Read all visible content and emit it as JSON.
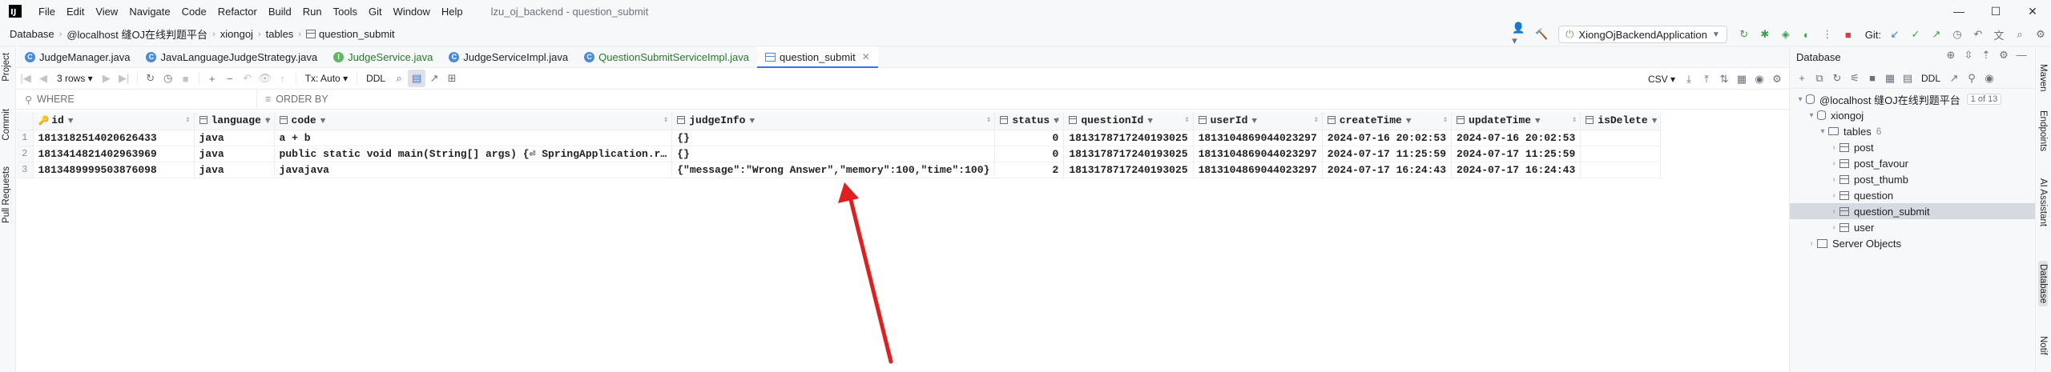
{
  "titlebar": {
    "app_logo": "IJ",
    "menu": [
      "File",
      "Edit",
      "View",
      "Navigate",
      "Code",
      "Refactor",
      "Build",
      "Run",
      "Tools",
      "Git",
      "Window",
      "Help"
    ],
    "window_title": "lzu_oj_backend - question_submit",
    "controls": {
      "minimize": "—",
      "maximize": "☐",
      "close": "✕"
    }
  },
  "navbar": {
    "breadcrumbs": [
      "Database",
      "@localhost 缝OJ在线判题平台",
      "xiongoj",
      "tables",
      "question_submit"
    ],
    "run_config": "XiongOjBackendApplication",
    "git_label": "Git:"
  },
  "left_strip": {
    "project": "Project",
    "commit": "Commit",
    "pull_requests": "Pull Requests"
  },
  "right_strip": {
    "maven": "Maven",
    "endpoints": "Endpoints",
    "ai_assistant": "AI Assistant",
    "database": "Database",
    "notifications": "Notif"
  },
  "editor_tabs": [
    {
      "label": "JudgeManager.java",
      "kind": "class"
    },
    {
      "label": "JavaLanguageJudgeStrategy.java",
      "kind": "class"
    },
    {
      "label": "JudgeService.java",
      "kind": "interface"
    },
    {
      "label": "JudgeServiceImpl.java",
      "kind": "class"
    },
    {
      "label": "QuestionSubmitServiceImpl.java",
      "kind": "class"
    },
    {
      "label": "question_submit",
      "kind": "table",
      "active": true
    }
  ],
  "grid_toolbar": {
    "rows_label": "3 rows",
    "tx_label": "Tx: Auto",
    "ddl_label": "DDL",
    "csv_label": "CSV"
  },
  "filter": {
    "where_label": "WHERE",
    "order_label": "ORDER BY"
  },
  "grid": {
    "columns": [
      "id",
      "language",
      "code",
      "judgeInfo",
      "status",
      "questionId",
      "userId",
      "createTime",
      "updateTime",
      "isDelete"
    ],
    "rows": [
      {
        "num": "1",
        "id": "1813182514020626433",
        "language": "java",
        "code": "a + b",
        "judgeInfo": "{}",
        "status": "0",
        "questionId": "1813178717240193025",
        "userId": "1813104869044023297",
        "createTime": "2024-07-16 20:02:53",
        "updateTime": "2024-07-16 20:02:53",
        "isDelete": ""
      },
      {
        "num": "2",
        "id": "1813414821402963969",
        "language": "java",
        "code": "public static void main(String[] args) {⏎     SpringApplication.r…",
        "judgeInfo": "{}",
        "status": "0",
        "questionId": "1813178717240193025",
        "userId": "1813104869044023297",
        "createTime": "2024-07-17 11:25:59",
        "updateTime": "2024-07-17 11:25:59",
        "isDelete": ""
      },
      {
        "num": "3",
        "id": "1813489999503876098",
        "language": "java",
        "code": "javajava",
        "judgeInfo": "{\"message\":\"Wrong Answer\",\"memory\":100,\"time\":100}",
        "status": "2",
        "questionId": "1813178717240193025",
        "userId": "1813104869044023297",
        "createTime": "2024-07-17 16:24:43",
        "updateTime": "2024-07-17 16:24:43",
        "isDelete": ""
      }
    ]
  },
  "db_panel": {
    "title": "Database",
    "ddl_label": "DDL",
    "tree": {
      "connection": {
        "label": "@localhost 缝OJ在线判题平台",
        "badge": "1 of 13"
      },
      "schema": "xiongoj",
      "tables_folder": {
        "label": "tables",
        "count": "6"
      },
      "tables": [
        "post",
        "post_favour",
        "post_thumb",
        "question",
        "question_submit",
        "user"
      ],
      "selected_table": "question_submit",
      "server_objects": "Server Objects"
    }
  },
  "annotation": {
    "color": "#e02020"
  }
}
